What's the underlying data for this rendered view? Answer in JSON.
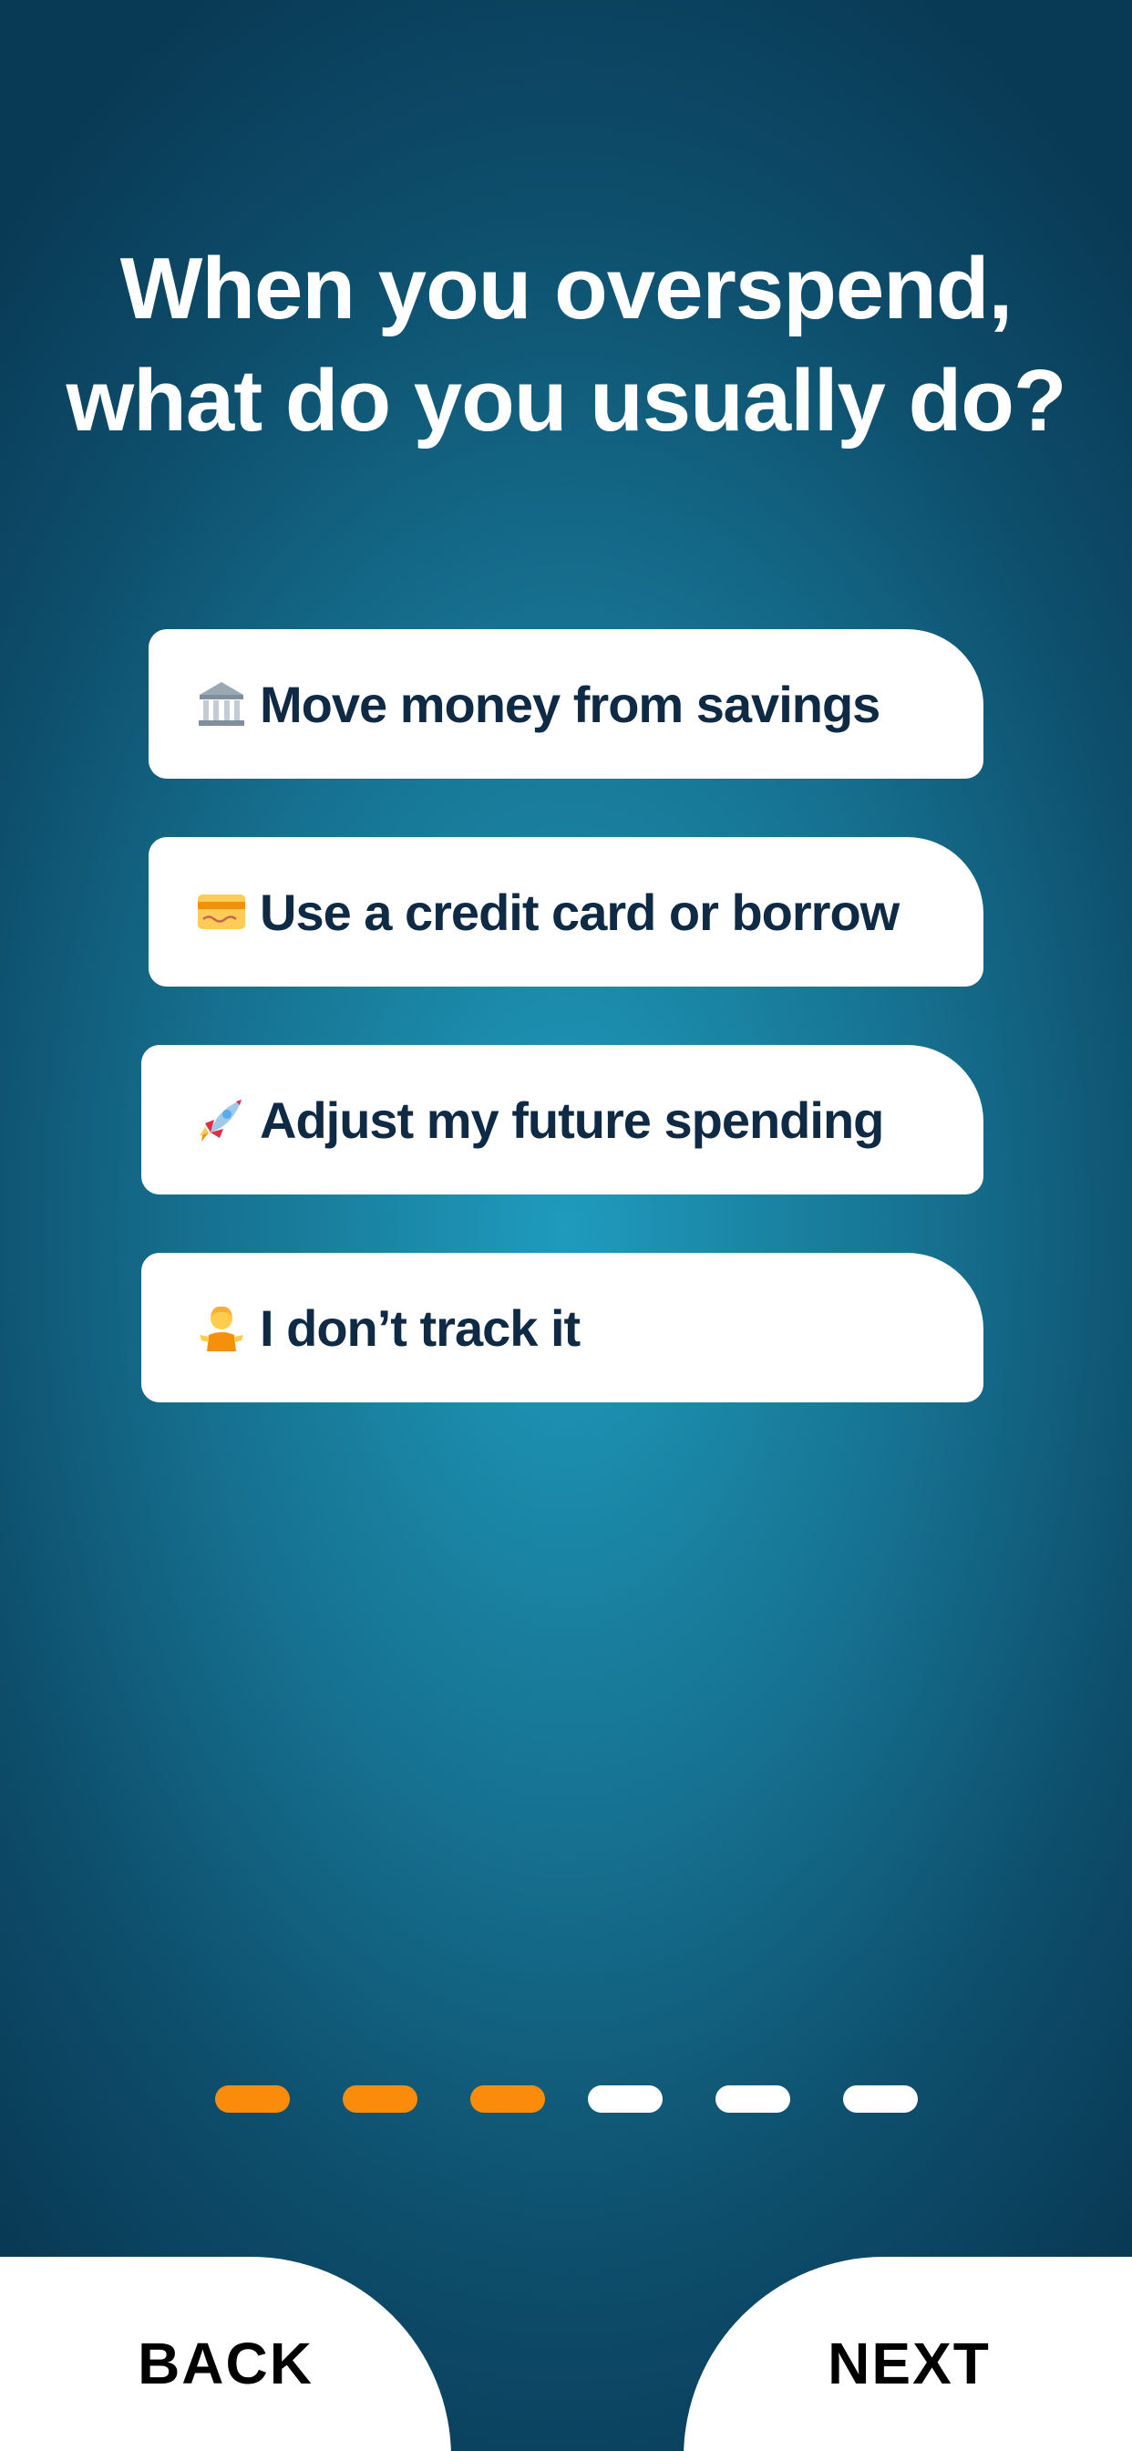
{
  "question": {
    "title": "When you overspend, what do you usually do?"
  },
  "options": [
    {
      "icon": "bank-icon",
      "label": "Move money from savings"
    },
    {
      "icon": "credit-card-icon",
      "label": "Use a credit card or borrow"
    },
    {
      "icon": "rocket-icon",
      "label": "Adjust my future spending"
    },
    {
      "icon": "person-shrugging-icon",
      "label": "I don’t track it"
    }
  ],
  "progress": {
    "total_steps": 6,
    "completed_steps": 3,
    "active_color": "#fb8c0b",
    "inactive_color": "#ffffff"
  },
  "navigation": {
    "back_label": "BACK",
    "next_label": "NEXT"
  }
}
